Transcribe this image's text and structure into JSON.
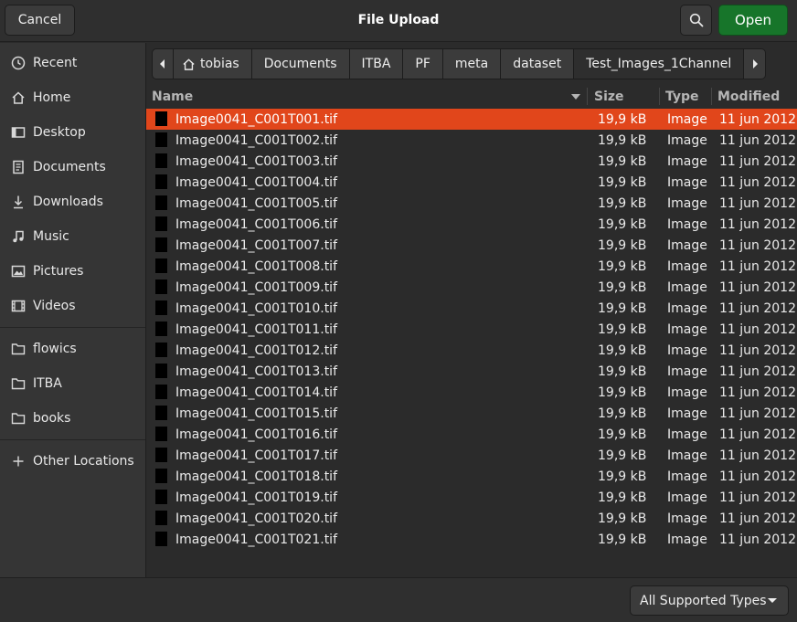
{
  "header": {
    "title": "File Upload",
    "cancel_label": "Cancel",
    "open_label": "Open",
    "search_icon": "search-icon"
  },
  "sidebar": {
    "items": [
      {
        "label": "Recent",
        "icon": "clock-icon"
      },
      {
        "label": "Home",
        "icon": "home-icon"
      },
      {
        "label": "Desktop",
        "icon": "desktop-icon"
      },
      {
        "label": "Documents",
        "icon": "document-icon"
      },
      {
        "label": "Downloads",
        "icon": "download-icon"
      },
      {
        "label": "Music",
        "icon": "music-icon"
      },
      {
        "label": "Pictures",
        "icon": "pictures-icon"
      },
      {
        "label": "Videos",
        "icon": "video-icon"
      },
      {
        "label": "flowics",
        "icon": "folder-icon"
      },
      {
        "label": "ITBA",
        "icon": "folder-icon"
      },
      {
        "label": "books",
        "icon": "folder-icon"
      },
      {
        "label": "Other Locations",
        "icon": "plus-icon"
      }
    ]
  },
  "pathbar": {
    "crumbs": [
      "tobias",
      "Documents",
      "ITBA",
      "PF",
      "meta",
      "dataset",
      "Test_Images_1Channel"
    ],
    "current": "Test_Images_1Channel"
  },
  "filelist": {
    "columns": {
      "name": "Name",
      "size": "Size",
      "type": "Type",
      "modified": "Modified"
    },
    "sort_column": "Name",
    "selected_index": 0,
    "rows": [
      {
        "name": "Image0041_C001T001.tif",
        "size": "19,9 kB",
        "type": "Image",
        "modified": "11 jun 2012"
      },
      {
        "name": "Image0041_C001T002.tif",
        "size": "19,9 kB",
        "type": "Image",
        "modified": "11 jun 2012"
      },
      {
        "name": "Image0041_C001T003.tif",
        "size": "19,9 kB",
        "type": "Image",
        "modified": "11 jun 2012"
      },
      {
        "name": "Image0041_C001T004.tif",
        "size": "19,9 kB",
        "type": "Image",
        "modified": "11 jun 2012"
      },
      {
        "name": "Image0041_C001T005.tif",
        "size": "19,9 kB",
        "type": "Image",
        "modified": "11 jun 2012"
      },
      {
        "name": "Image0041_C001T006.tif",
        "size": "19,9 kB",
        "type": "Image",
        "modified": "11 jun 2012"
      },
      {
        "name": "Image0041_C001T007.tif",
        "size": "19,9 kB",
        "type": "Image",
        "modified": "11 jun 2012"
      },
      {
        "name": "Image0041_C001T008.tif",
        "size": "19,9 kB",
        "type": "Image",
        "modified": "11 jun 2012"
      },
      {
        "name": "Image0041_C001T009.tif",
        "size": "19,9 kB",
        "type": "Image",
        "modified": "11 jun 2012"
      },
      {
        "name": "Image0041_C001T010.tif",
        "size": "19,9 kB",
        "type": "Image",
        "modified": "11 jun 2012"
      },
      {
        "name": "Image0041_C001T011.tif",
        "size": "19,9 kB",
        "type": "Image",
        "modified": "11 jun 2012"
      },
      {
        "name": "Image0041_C001T012.tif",
        "size": "19,9 kB",
        "type": "Image",
        "modified": "11 jun 2012"
      },
      {
        "name": "Image0041_C001T013.tif",
        "size": "19,9 kB",
        "type": "Image",
        "modified": "11 jun 2012"
      },
      {
        "name": "Image0041_C001T014.tif",
        "size": "19,9 kB",
        "type": "Image",
        "modified": "11 jun 2012"
      },
      {
        "name": "Image0041_C001T015.tif",
        "size": "19,9 kB",
        "type": "Image",
        "modified": "11 jun 2012"
      },
      {
        "name": "Image0041_C001T016.tif",
        "size": "19,9 kB",
        "type": "Image",
        "modified": "11 jun 2012"
      },
      {
        "name": "Image0041_C001T017.tif",
        "size": "19,9 kB",
        "type": "Image",
        "modified": "11 jun 2012"
      },
      {
        "name": "Image0041_C001T018.tif",
        "size": "19,9 kB",
        "type": "Image",
        "modified": "11 jun 2012"
      },
      {
        "name": "Image0041_C001T019.tif",
        "size": "19,9 kB",
        "type": "Image",
        "modified": "11 jun 2012"
      },
      {
        "name": "Image0041_C001T020.tif",
        "size": "19,9 kB",
        "type": "Image",
        "modified": "11 jun 2012"
      },
      {
        "name": "Image0041_C001T021.tif",
        "size": "19,9 kB",
        "type": "Image",
        "modified": "11 jun 2012"
      }
    ]
  },
  "footer": {
    "filter_label": "All Supported Types"
  },
  "colors": {
    "accent_selected": "#e1461b",
    "open_button": "#17752a",
    "background": "#2b2b2b"
  }
}
